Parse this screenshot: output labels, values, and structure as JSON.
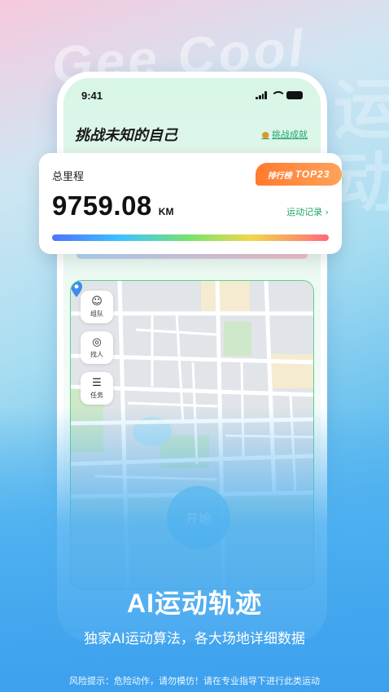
{
  "background": {
    "brand_text": "Gee Cool",
    "side_glyphs": "运动"
  },
  "phone": {
    "status_time": "9:41",
    "headline": "挑战未知的自己",
    "achievement_link": "挑战成就",
    "map": {
      "side_buttons": [
        {
          "glyph": "☺",
          "label": "组队",
          "icon": "team-icon"
        },
        {
          "glyph": "◎",
          "label": "找人",
          "icon": "find-person-icon"
        },
        {
          "glyph": "☰",
          "label": "任务",
          "icon": "task-icon"
        }
      ],
      "start_label": "开始"
    }
  },
  "stat_card": {
    "label": "总里程",
    "rank_label": "排行榜",
    "rank_value": "TOP23",
    "value": "9759.08",
    "unit": "KM",
    "record_link": "运动记录 ›"
  },
  "feature": {
    "title": "AI运动轨迹",
    "subtitle": "独家AI运动算法，各大场地详细数据"
  },
  "disclaimer": "风险提示：危险动作，请勿模仿！请在专业指导下进行此类运动",
  "colors": {
    "accent_green": "#1fa66a",
    "rank_orange": "#ff7a2e",
    "background_blue": "#2f97ee"
  }
}
